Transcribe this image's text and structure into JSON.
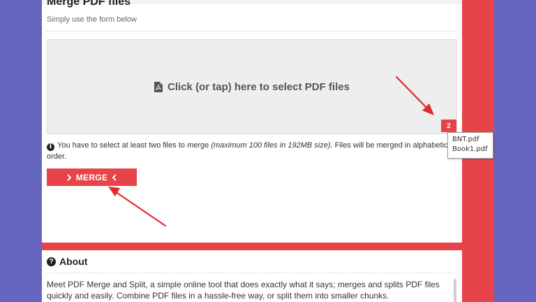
{
  "header": {
    "title": "Merge PDF files",
    "subtitle": "Simply use the form below"
  },
  "dropzone": {
    "label": "Click (or tap) here to select PDF files",
    "icon": "pdf-file-icon"
  },
  "file_count": "2",
  "info": {
    "icon": "info-circle-icon",
    "text_before": "You have to select at least two files to merge ",
    "text_emphasis": "(maximum 100 files in 192MB size)",
    "text_after": ". Files will be merged in alphabetical order."
  },
  "merge_button": {
    "label": "MERGE"
  },
  "about": {
    "title": "About",
    "icon": "question-circle-icon",
    "text": "Meet PDF Merge and Split, a simple online tool that does exactly what it says; merges and splits PDF files quickly and easily. Combine PDF files in a hassle-free way, or split them into smaller chunks."
  },
  "tooltip": {
    "files": [
      "BNT.pdf",
      "Book1.pdf"
    ]
  },
  "colors": {
    "accent": "#e7444a",
    "background": "#6566c0",
    "annotation_arrow": "#e02b2b"
  }
}
